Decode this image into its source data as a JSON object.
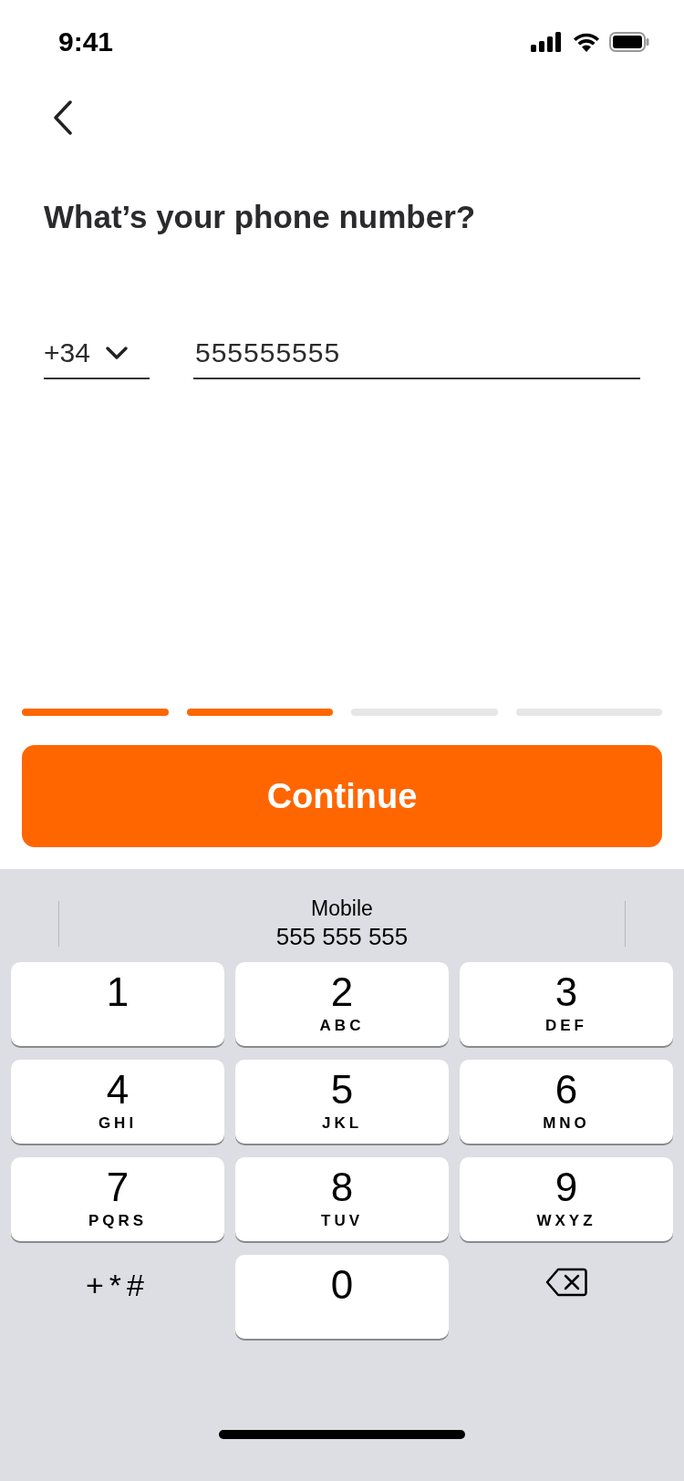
{
  "status_bar": {
    "time": "9:41"
  },
  "title": "What’s your phone number?",
  "phone": {
    "country_code": "+34",
    "value": "555555555"
  },
  "progress": [
    {
      "done": true
    },
    {
      "done": true
    },
    {
      "done": false
    },
    {
      "done": false
    }
  ],
  "continue_button": "Continue",
  "keyboard": {
    "suggestion": {
      "label": "Mobile",
      "number": "555 555 555"
    },
    "keys": [
      {
        "kind": "digit",
        "digit": "1"
      },
      {
        "kind": "digit",
        "digit": "2",
        "letters": "ABC"
      },
      {
        "kind": "digit",
        "digit": "3",
        "letters": "DEF"
      },
      {
        "kind": "digit",
        "digit": "4",
        "letters": "GHI"
      },
      {
        "kind": "digit",
        "digit": "5",
        "letters": "JKL"
      },
      {
        "kind": "digit",
        "digit": "6",
        "letters": "MNO"
      },
      {
        "kind": "digit",
        "digit": "7",
        "letters": "PQRS"
      },
      {
        "kind": "digit",
        "digit": "8",
        "letters": "TUV"
      },
      {
        "kind": "digit",
        "digit": "9",
        "letters": "WXYZ"
      },
      {
        "kind": "symbols",
        "label": "+*#"
      },
      {
        "kind": "digit",
        "digit": "0"
      },
      {
        "kind": "delete"
      }
    ]
  }
}
